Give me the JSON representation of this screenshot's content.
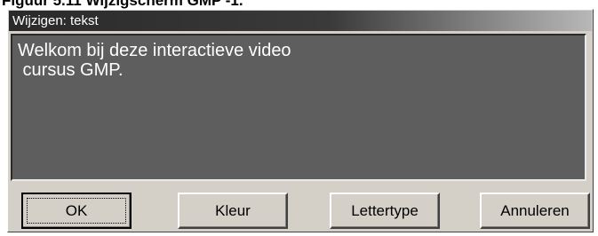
{
  "caption": "Figuur 5.11 Wijzigscherm GMP -1.",
  "window": {
    "title": "Wijzigen: tekst"
  },
  "editor": {
    "lines": [
      "Welkom bij deze interactieve video",
      " cursus GMP."
    ]
  },
  "buttons": {
    "ok": "OK",
    "kleur": "Kleur",
    "lettertype": "Lettertype",
    "annuleren": "Annuleren"
  }
}
